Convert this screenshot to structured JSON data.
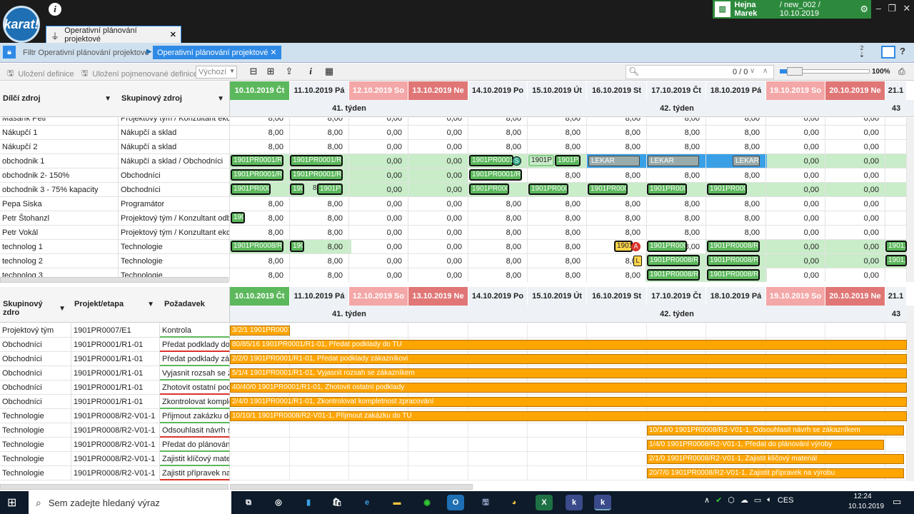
{
  "app": {
    "logo_text": "karat!",
    "info_icon": "i"
  },
  "tab": {
    "label": "Operativní plánování projektové",
    "close": "✕"
  },
  "user": {
    "name": "Hejna Marek",
    "context": " / new_002 / 10.10.2019"
  },
  "breadcrumb": {
    "filter": "Filtr Operativní plánování projektové",
    "current": "Operativní plánování projektové",
    "close": "✕"
  },
  "sort_badge": "2",
  "toolbar": {
    "save_def": "Uložení definice",
    "save_named": "Uložení pojmenované definice",
    "default_option": "Výchozí"
  },
  "search": {
    "count": "0 / 0"
  },
  "zoom": {
    "value": "100%",
    "level": 0.1
  },
  "top_grid": {
    "columns": [
      {
        "label": "Dílčí zdroj"
      },
      {
        "label": "Skupinový zdroj"
      }
    ],
    "days": [
      {
        "label": "10.10.2019 Čt",
        "kind": "today"
      },
      {
        "label": "11.10.2019 Pá",
        "kind": "norm"
      },
      {
        "label": "12.10.2019 So",
        "kind": "sat"
      },
      {
        "label": "13.10.2019 Ne",
        "kind": "sun"
      },
      {
        "label": "14.10.2019 Po",
        "kind": "norm"
      },
      {
        "label": "15.10.2019 Út",
        "kind": "norm"
      },
      {
        "label": "16.10.2019 St",
        "kind": "norm"
      },
      {
        "label": "17.10.2019 Čt",
        "kind": "norm"
      },
      {
        "label": "18.10.2019 Pá",
        "kind": "norm"
      },
      {
        "label": "19.10.2019 So",
        "kind": "sat"
      },
      {
        "label": "20.10.2019 Ne",
        "kind": "sun"
      },
      {
        "label": "21.1",
        "kind": "norm"
      }
    ],
    "weeks": {
      "w41": "41. týden",
      "w42": "42. týden",
      "w43": "43"
    },
    "rows": [
      {
        "name": "Masařík Petr",
        "group": "Projektový tým / Konzultant ekono",
        "values": [
          "8,00",
          "8,00",
          "0,00",
          "0,00",
          "8,00",
          "8,00",
          "8,00",
          "8,00",
          "8,00",
          "0,00",
          "0,00"
        ]
      },
      {
        "name": "Nákupčí 1",
        "group": "Nákupčí a sklad",
        "values": [
          "8,00",
          "8,00",
          "0,00",
          "0,00",
          "8,00",
          "8,00",
          "8,00",
          "8,00",
          "8,00",
          "0,00",
          "0,00"
        ]
      },
      {
        "name": "Nákupčí 2",
        "group": "Nákupčí a sklad",
        "values": [
          "8,00",
          "8,00",
          "0,00",
          "0,00",
          "8,00",
          "8,00",
          "8,00",
          "8,00",
          "8,00",
          "0,00",
          "0,00"
        ]
      },
      {
        "name": "obchodnik 1",
        "group": "Nákupčí a sklad / Obchodníci",
        "values": [
          "",
          "",
          "0,00",
          "0,00",
          "",
          "",
          "",
          "",
          "",
          "0,00",
          "0,00"
        ]
      },
      {
        "name": "obchodnik 2- 150%",
        "group": "Obchodníci",
        "values": [
          "",
          "",
          "0,00",
          "0,00",
          "",
          "8,00",
          "8,00",
          "8,00",
          "8,00",
          "0,00",
          "0,00"
        ]
      },
      {
        "name": "obchodnik 3 - 75% kapacity",
        "group": "Obchodníci",
        "values": [
          "",
          "",
          "0,00",
          "0,00",
          "",
          "",
          "",
          "",
          "",
          "0,00",
          "0,00"
        ]
      },
      {
        "name": "Pepa Siska",
        "group": "Programátor",
        "values": [
          "8,00",
          "8,00",
          "0,00",
          "0,00",
          "8,00",
          "8,00",
          "8,00",
          "8,00",
          "8,00",
          "0,00",
          "0,00"
        ]
      },
      {
        "name": "Petr Štohanzl",
        "group": "Projektový tým / Konzultant odbyt",
        "values": [
          "8,00",
          "8,00",
          "0,00",
          "0,00",
          "8,00",
          "8,00",
          "8,00",
          "8,00",
          "8,00",
          "0,00",
          "0,00"
        ]
      },
      {
        "name": "Petr Vokál",
        "group": "Projektový tým / Konzultant ekono",
        "values": [
          "8,00",
          "8,00",
          "0,00",
          "0,00",
          "8,00",
          "8,00",
          "8,00",
          "8,00",
          "8,00",
          "0,00",
          "0,00"
        ]
      },
      {
        "name": "technolog 1",
        "group": "Technologie",
        "values": [
          "",
          "8,00",
          "0,00",
          "0,00",
          "8,00",
          "8,00",
          "8",
          "8,00",
          "",
          "0,00",
          "0,00"
        ]
      },
      {
        "name": "technolog 2",
        "group": "Technologie",
        "values": [
          "8,00",
          "8,00",
          "0,00",
          "0,00",
          "8,00",
          "8,00",
          "8,00",
          "",
          "",
          "0,00",
          "0,00"
        ]
      },
      {
        "name": "technolog 3",
        "group": "Technologie",
        "values": [
          "8,00",
          "8,00",
          "0,00",
          "0,00",
          "8,00",
          "8,00",
          "8,00",
          "",
          "",
          "0,00",
          "0,00"
        ]
      }
    ],
    "activities": {
      "a1": "1901PR0001/R",
      "a2": "1901PR0001/R1",
      "a3": "1901PR0001/",
      "a4": "1901P",
      "a5": "1901PR",
      "lekar": "LEKAR",
      "b1": "1901PR0001/R1",
      "b2": "1901PR0001/R1",
      "b3": "1901PR0001/R1",
      "c1": "1901PR000,",
      "c2": "190",
      "c3": "8",
      "c4": "1901PR",
      "c5": "1901PR000,",
      "d1": "190",
      "e1": "1901PR0008/R2",
      "e2": "190",
      "e3": "1901",
      "e4": "1901PR000,",
      "e5": "1901PR0008/R2",
      "e6": "1901,",
      "f1": "1901PR0008/R2",
      "f2": "1901PR0008/R2",
      "f3": "1901,",
      "g1": "1901PR0008/R2",
      "g2": "1901PR0008/R2",
      "badge_s": "S",
      "badge_a": "A",
      "badge_l": "L"
    }
  },
  "bottom_grid": {
    "columns": [
      {
        "label": "Skupinový zdro"
      },
      {
        "label": "Projekt/etapa"
      },
      {
        "label": "Požadavek"
      }
    ],
    "rows": [
      {
        "group": "Projektový tým",
        "project": "1901PR0007/E1",
        "req": "Kontrola",
        "bar": "3/2/1 1901PR0007"
      },
      {
        "group": "Obchodníci",
        "project": "1901PR0001/R1-01",
        "req": "Předat podklady do T",
        "bar": "80/85/16 1901PR0001/R1-01, Předat podklady do TÚ"
      },
      {
        "group": "Obchodníci",
        "project": "1901PR0001/R1-01",
        "req": "Předat podklady záka",
        "bar": "2/2/0 1901PR0001/R1-01, Předat podklady zákazníkovi"
      },
      {
        "group": "Obchodníci",
        "project": "1901PR0001/R1-01",
        "req": "Vyjasnit rozsah se zá",
        "bar": "5/1/4 1901PR0001/R1-01, Vyjasnit rozsah se zákazníkem"
      },
      {
        "group": "Obchodníci",
        "project": "1901PR0001/R1-01",
        "req": "Zhotovit ostatní podl",
        "bar": "40/40/0 1901PR0001/R1-01, Zhotovit ostatní podklady"
      },
      {
        "group": "Obchodníci",
        "project": "1901PR0001/R1-01",
        "req": "Zkontrolovat komple",
        "bar": "2/4/0 1901PR0001/R1-01, Zkontrolovat kompletnost zpracování"
      },
      {
        "group": "Technologie",
        "project": "1901PR0008/R2-V01-1",
        "req": "Přijmout zakázku do",
        "bar": "10/10/1 1901PR0008/R2-V01-1, Přijmout zakázku do TÚ"
      },
      {
        "group": "Technologie",
        "project": "1901PR0008/R2-V01-1",
        "req": "Odsouhlasit návrh se",
        "bar": "10/14/0 1901PR0008/R2-V01-1, Odsouhlasit návrh se zákazníkem"
      },
      {
        "group": "Technologie",
        "project": "1901PR0008/R2-V01-1",
        "req": "Předat do plánování",
        "bar": "1/4/0 1901PR0008/R2-V01-1, Předat do plánování výroby"
      },
      {
        "group": "Technologie",
        "project": "1901PR0008/R2-V01-1",
        "req": "Zajistit klíčový materi",
        "bar": "2/1/0 1901PR0008/R2-V01-1, Zajistit klíčový materiál"
      },
      {
        "group": "Technologie",
        "project": "1901PR0008/R2-V01-1",
        "req": "Zajistit přípravek na v",
        "bar": "20/7/0 1901PR0008/R2-V01-1, Zajistit přípravek na výrobu"
      }
    ]
  },
  "taskbar": {
    "search_placeholder": "Sem zadejte hledaný výraz",
    "lang": "CES",
    "time": "12:24",
    "date": "10.10.2019"
  },
  "colors": {
    "accent": "#2e8ae6",
    "today": "#5cb85c",
    "saturday": "#f4a7a7",
    "sunday": "#e07676",
    "bar": "#ffa500",
    "user_bar": "#2d8a3d"
  }
}
